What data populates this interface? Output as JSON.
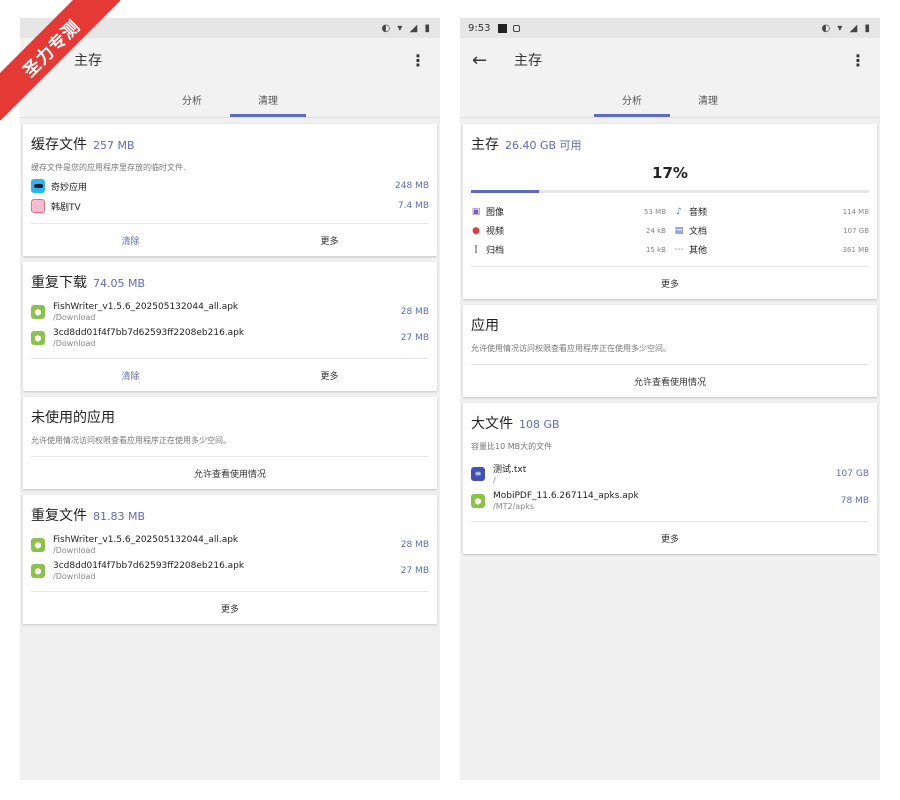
{
  "watermark": "圣力专测",
  "left": {
    "status": {
      "time": "",
      "icons": "◐ ▾ ◢ ▮"
    },
    "appbar": {
      "title": "主存",
      "menu": "⋮"
    },
    "tabs": [
      {
        "label": "分析"
      },
      {
        "label": "清理"
      }
    ],
    "cache": {
      "title": "缓存文件",
      "size": "257 MB",
      "desc": "缓存文件是您的应用程序里存放的临时文件.",
      "items": [
        {
          "name": "奇妙应用",
          "size": "248 MB"
        },
        {
          "name": "韩剧TV",
          "size": "7.4 MB"
        }
      ],
      "clear": "清除",
      "more": "更多"
    },
    "dup_downloads": {
      "title": "重复下载",
      "size": "74.05 MB",
      "items": [
        {
          "name": "FishWriter_v1.5.6_202505132044_all.apk",
          "path": "/Download",
          "size": "28 MB"
        },
        {
          "name": "3cd8dd01f4f7bb7d62593ff2208eb216.apk",
          "path": "/Download",
          "size": "27 MB"
        }
      ],
      "clear": "清除",
      "more": "更多"
    },
    "unused": {
      "title": "未使用的应用",
      "desc": "允许使用情况访问权限查看应用程序正在使用多少空间。",
      "allow": "允许查看使用情况"
    },
    "dup_files": {
      "title": "重复文件",
      "size": "81.83 MB",
      "items": [
        {
          "name": "FishWriter_v1.5.6_202505132044_all.apk",
          "path": "/Download",
          "size": "28 MB"
        },
        {
          "name": "3cd8dd01f4f7bb7d62593ff2208eb216.apk",
          "path": "/Download",
          "size": "27 MB"
        }
      ],
      "more": "更多"
    }
  },
  "right": {
    "status": {
      "time": "9:53",
      "icons": "◐ ▾ ◢ ▮"
    },
    "appbar": {
      "back": "←",
      "title": "主存",
      "menu": "⋮"
    },
    "tabs": [
      {
        "label": "分析"
      },
      {
        "label": "清理"
      }
    ],
    "storage": {
      "title": "主存",
      "available": "26.40 GB 可用",
      "percent_label": "17%",
      "used_fraction": 0.17,
      "legend": [
        {
          "icon": "▣",
          "color": "#7e57c2",
          "name": "图像",
          "value": "53 MB"
        },
        {
          "icon": "♪",
          "color": "#1e88e5",
          "name": "音频",
          "value": "114 MB"
        },
        {
          "icon": "●",
          "color": "#e53935",
          "name": "视频",
          "value": "24 kB"
        },
        {
          "icon": "▤",
          "color": "#3f51b5",
          "name": "文档",
          "value": "107 GB"
        },
        {
          "icon": "⫿",
          "color": "#666666",
          "name": "归档",
          "value": "15 kB"
        },
        {
          "icon": "⋯",
          "color": "#666666",
          "name": "其他",
          "value": "361 MB"
        }
      ],
      "more": "更多"
    },
    "apps": {
      "title": "应用",
      "desc": "允许使用情况访问权限查看应用程序正在使用多少空间。",
      "allow": "允许查看使用情况"
    },
    "large": {
      "title": "大文件",
      "size": "108 GB",
      "desc": "容量比10 MB大的文件",
      "items": [
        {
          "name": "测试.txt",
          "path": "/",
          "size": "107 GB",
          "type": "txt"
        },
        {
          "name": "MobiPDF_11.6.267114_apks.apk",
          "path": "/MT2/apks",
          "size": "78 MB",
          "type": "apk"
        }
      ],
      "more": "更多"
    }
  }
}
